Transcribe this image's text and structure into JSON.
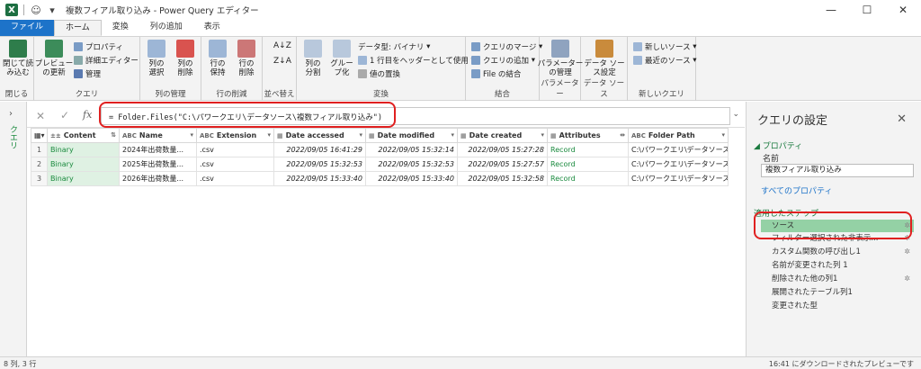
{
  "window": {
    "title": "複数フィアル取り込み - Power Query エディター"
  },
  "menu_tabs": [
    "ファイル",
    "ホーム",
    "変換",
    "列の追加",
    "表示"
  ],
  "ribbon": {
    "close_group": {
      "btn": "閉じて読\nみ込む",
      "label": "閉じる"
    },
    "query_group": {
      "preview": "プレビュー\nの更新",
      "props": "プロパティ",
      "adv": "詳細エディター",
      "manage": "管理",
      "label": "クエリ"
    },
    "cols_group": {
      "select": "列の\n選択",
      "remove": "列の\n削除",
      "label": "列の管理"
    },
    "rows_group": {
      "keep": "行の\n保持",
      "remove": "行の\n削除",
      "label": "行の削減"
    },
    "sort_group": {
      "label": "並べ替え"
    },
    "transform_group": {
      "split": "列の\n分割",
      "group": "グルー\nプ化",
      "datatype": "データ型: バイナリ",
      "header": "1 行目をヘッダーとして使用",
      "replace": "値の置換",
      "label": "変換"
    },
    "combine_group": {
      "merge": "クエリのマージ",
      "append": "クエリの追加",
      "file": "File の結合",
      "label": "結合"
    },
    "param_group": {
      "btn": "パラメーター\nの管理",
      "label": "パラメーター"
    },
    "ds_group": {
      "btn": "データ ソー\nス設定",
      "label": "データ ソース"
    },
    "newq_group": {
      "new": "新しいソース",
      "recent": "最近のソース",
      "label": "新しいクエリ"
    }
  },
  "left_rail": {
    "label": "クエリ"
  },
  "formula": {
    "text": "= Folder.Files(\"C:\\パワークエリ\\データソース\\複数フィアル取り込み\")"
  },
  "grid": {
    "headers": [
      {
        "name": "Content",
        "type": "±±"
      },
      {
        "name": "Name",
        "type": "ABC"
      },
      {
        "name": "Extension",
        "type": "ABC"
      },
      {
        "name": "Date accessed",
        "type": "▦"
      },
      {
        "name": "Date modified",
        "type": "▦"
      },
      {
        "name": "Date created",
        "type": "▦"
      },
      {
        "name": "Attributes",
        "type": "▦"
      },
      {
        "name": "Folder Path",
        "type": "ABC"
      }
    ],
    "rows": [
      {
        "n": "1",
        "content": "Binary",
        "name": "2024年出荷数量...",
        "ext": ".csv",
        "acc": "2022/09/05 16:41:29",
        "mod": "2022/09/05 15:32:14",
        "cre": "2022/09/05 15:27:28",
        "attr": "Record",
        "path": "C:\\パワークエリ\\データソース\\..."
      },
      {
        "n": "2",
        "content": "Binary",
        "name": "2025年出荷数量...",
        "ext": ".csv",
        "acc": "2022/09/05 15:32:53",
        "mod": "2022/09/05 15:32:53",
        "cre": "2022/09/05 15:27:57",
        "attr": "Record",
        "path": "C:\\パワークエリ\\データソース\\..."
      },
      {
        "n": "3",
        "content": "Binary",
        "name": "2026年出荷数量...",
        "ext": ".csv",
        "acc": "2022/09/05 15:33:40",
        "mod": "2022/09/05 15:33:40",
        "cre": "2022/09/05 15:32:58",
        "attr": "Record",
        "path": "C:\\パワークエリ\\データソース\\..."
      }
    ]
  },
  "settings": {
    "title": "クエリの設定",
    "props_section": "◢ プロパティ",
    "name_label": "名前",
    "name_value": "複数フィアル取り込み",
    "all_props": "すべてのプロパティ",
    "steps_section": "適用したステップ",
    "steps": [
      "ソース",
      "フィルター選択された非表示...",
      "カスタム関数の呼び出し1",
      "名前が変更された列 1",
      "削除された他の列1",
      "展開されたテーブル列1",
      "変更された型"
    ]
  },
  "status": {
    "left": "8 列, 3 行",
    "right": "16:41 にダウンロードされたプレビューです"
  }
}
